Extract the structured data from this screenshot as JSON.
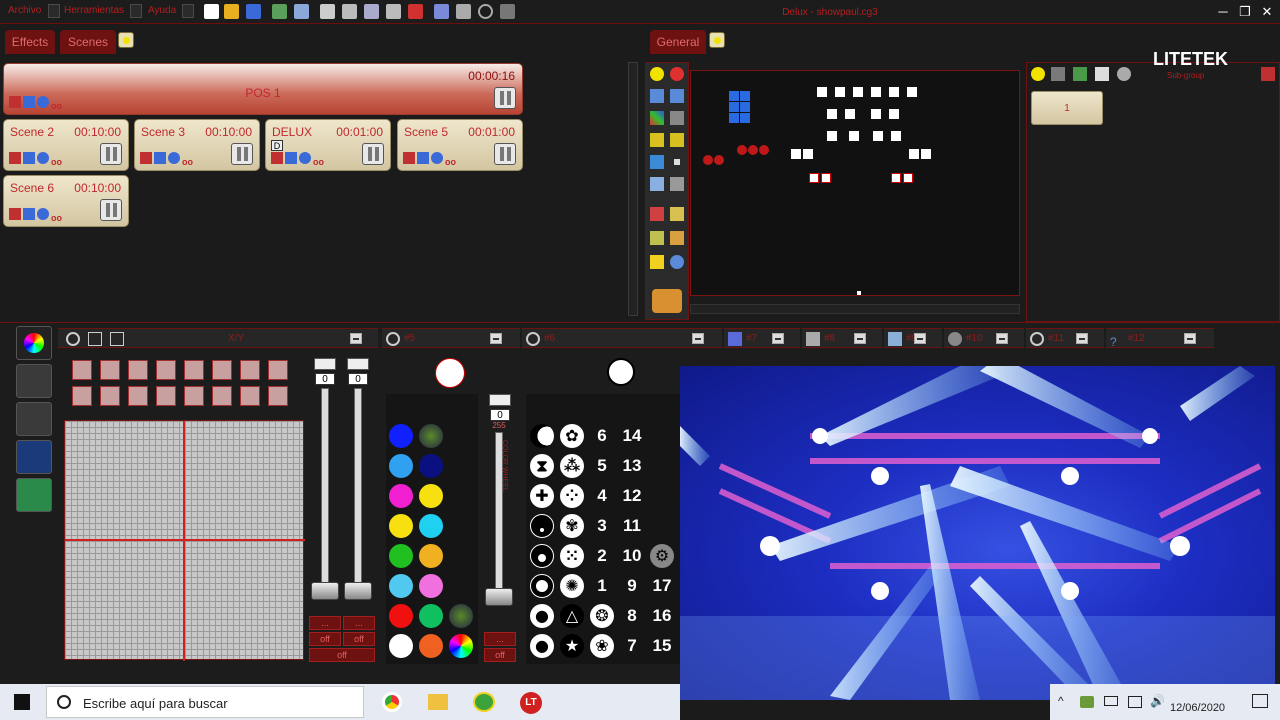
{
  "menu": {
    "archivo": "Archivo",
    "herramientas": "Herramientas",
    "ayuda": "Ayuda"
  },
  "window_title": "Delux - showpaul.cg3",
  "tabs": {
    "effects": "Effects",
    "scenes": "Scenes",
    "general": "General"
  },
  "scenes": [
    {
      "name": "POS 1",
      "time": "00:00:16"
    },
    {
      "name": "Scene 2",
      "time": "00:10:00"
    },
    {
      "name": "Scene 3",
      "time": "00:10:00"
    },
    {
      "name": "DELUX",
      "time": "00:01:00"
    },
    {
      "name": "Scene 5",
      "time": "00:01:00"
    },
    {
      "name": "Scene 6",
      "time": "00:10:00"
    }
  ],
  "scene_icons_text": "oo",
  "delux_badge": "D",
  "right_panel": {
    "button_label": "1"
  },
  "logo": {
    "text": "LITETEK",
    "subtitle": "Sub-group"
  },
  "bottom_headers": {
    "xy": "X/Y",
    "h5": "#5",
    "h6": "#6",
    "h7": "#7",
    "h8": "#8",
    "h9": "#9",
    "h10": "#10",
    "h11": "#11",
    "h12": "#12"
  },
  "faders": {
    "f1": "0",
    "f2": "0",
    "f3": "0",
    "f3_max": "255",
    "off": "off",
    "dots": "...",
    "f3_min": "0"
  },
  "color_wheel_label": "COLOR WHEEL",
  "gobo_numbers": [
    "6",
    "14",
    "5",
    "13",
    "4",
    "12",
    "3",
    "11",
    "2",
    "10",
    "1",
    "9",
    "17",
    "8",
    "16",
    "7",
    "15"
  ],
  "taskbar": {
    "search_placeholder": "Escribe aquí para buscar",
    "date": "12/06/2020"
  },
  "colors": {
    "accent_red": "#b41e1e",
    "panel_border": "#6e1111",
    "scene_bg": "#e6dcc0"
  }
}
